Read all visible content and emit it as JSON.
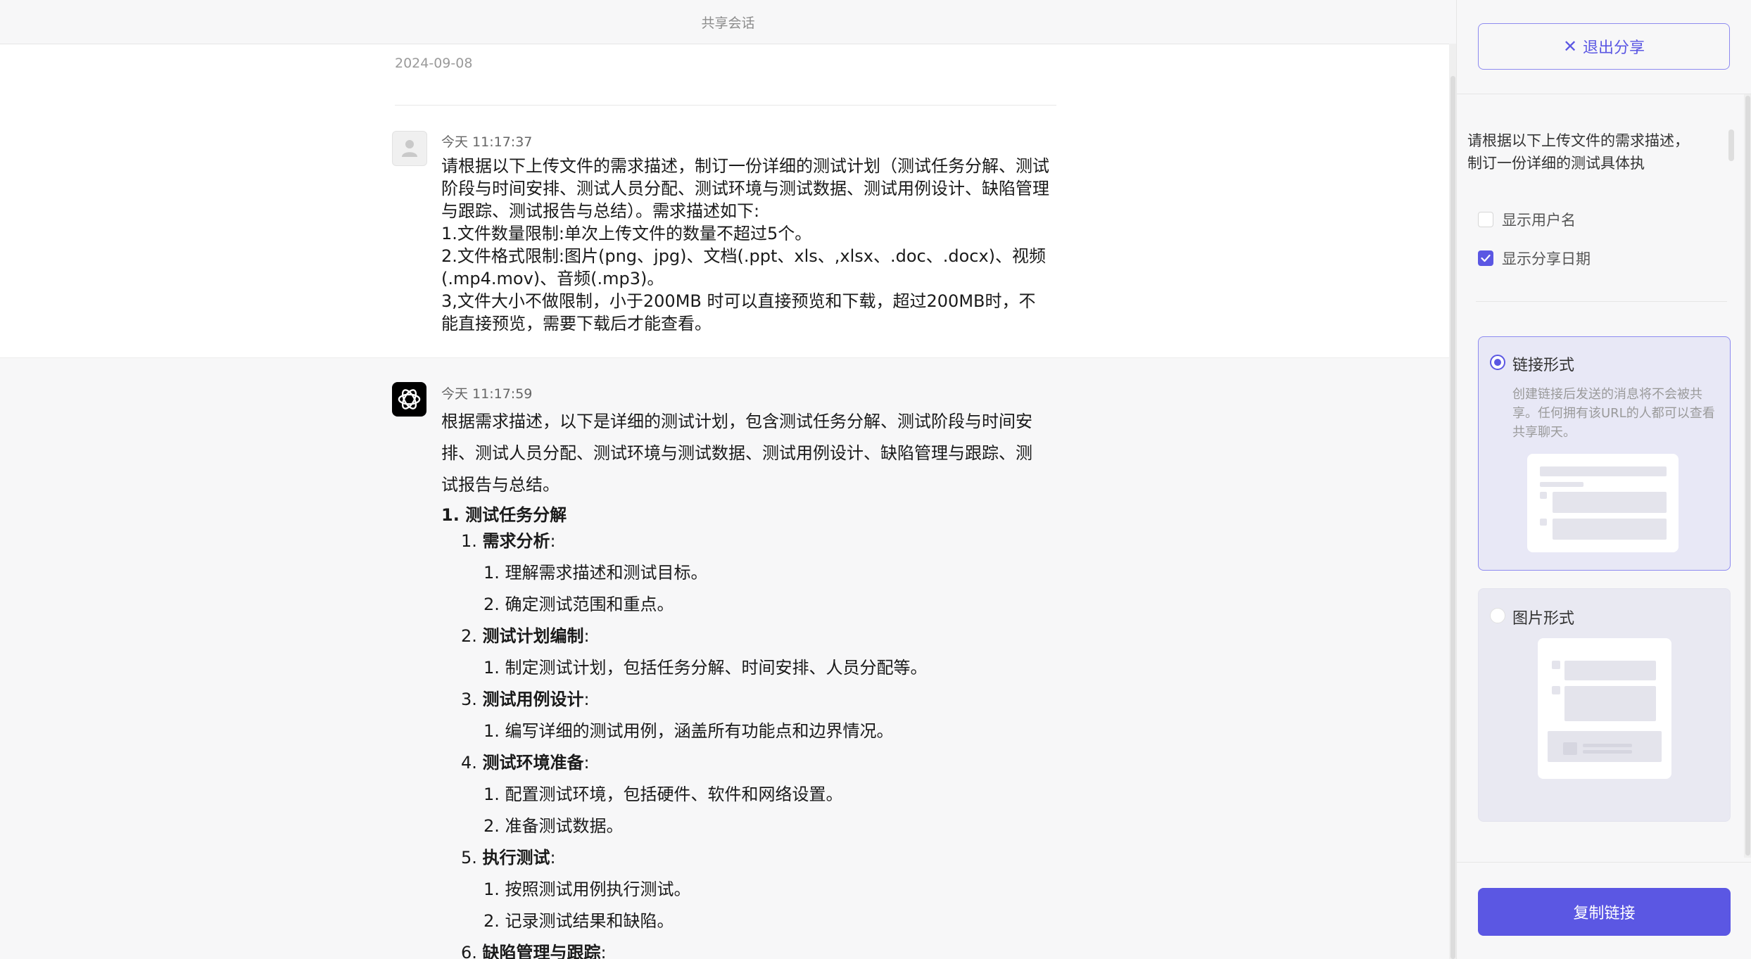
{
  "topbar": {
    "title": "共享会话"
  },
  "conversation": {
    "date": "2024-09-08",
    "user_message": {
      "time": "今天 11:17:37",
      "lines": [
        "请根据以下上传文件的需求描述，制订一份详细的测试计划（测试任务分解、测试阶段与时间安排、测试人员分配、测试环境与测试数据、测试用例设计、缺陷管理与跟踪、测试报告与总结）。需求描述如下:",
        "1.文件数量限制:单次上传文件的数量不超过5个。",
        "2.文件格式限制:图片(png、jpg)、文档(.ppt、xls、,xlsx、.doc、.docx)、视频(.mp4.mov)、音频(.mp3)。",
        "3,文件大小不做限制，小于200MB 时可以直接预览和下载，超过200MB时，不能直接预览，需要下载后才能查看。"
      ]
    },
    "ai_message": {
      "time": "今天 11:17:59",
      "intro": "根据需求描述，以下是详细的测试计划，包含测试任务分解、测试阶段与时间安排、测试人员分配、测试环境与测试数据、测试用例设计、缺陷管理与跟踪、测试报告与总结。",
      "section_title": "1. 测试任务分解",
      "tasks": [
        {
          "num": "1.",
          "title": "需求分析",
          "subs": [
            {
              "num": "1.",
              "text": "理解需求描述和测试目标。"
            },
            {
              "num": "2.",
              "text": "确定测试范围和重点。"
            }
          ]
        },
        {
          "num": "2.",
          "title": "测试计划编制",
          "subs": [
            {
              "num": "1.",
              "text": "制定测试计划，包括任务分解、时间安排、人员分配等。"
            }
          ]
        },
        {
          "num": "3.",
          "title": "测试用例设计",
          "subs": [
            {
              "num": "1.",
              "text": "编写详细的测试用例，涵盖所有功能点和边界情况。"
            }
          ]
        },
        {
          "num": "4.",
          "title": "测试环境准备",
          "subs": [
            {
              "num": "1.",
              "text": "配置测试环境，包括硬件、软件和网络设置。"
            },
            {
              "num": "2.",
              "text": "准备测试数据。"
            }
          ]
        },
        {
          "num": "5.",
          "title": "执行测试",
          "subs": [
            {
              "num": "1.",
              "text": "按照测试用例执行测试。"
            },
            {
              "num": "2.",
              "text": "记录测试结果和缺陷。"
            }
          ]
        },
        {
          "num": "6.",
          "title": "缺陷管理与跟踪",
          "subs": []
        }
      ],
      "colon": ":"
    }
  },
  "share_panel": {
    "exit_label": "退出分享",
    "preview_text": "请根据以下上传文件的需求描述，制订一份详细的测试具体执",
    "show_username_label": "显示用户名",
    "show_username_checked": false,
    "show_date_label": "显示分享日期",
    "show_date_checked": true,
    "options": {
      "link": {
        "label": "链接形式",
        "selected": true,
        "description": "创建链接后发送的消息将不会被共享。任何拥有该URL的人都可以查看共享聊天。"
      },
      "image": {
        "label": "图片形式",
        "selected": false
      }
    },
    "copy_button_label": "复制链接",
    "accent_color": "#5b57e3"
  }
}
